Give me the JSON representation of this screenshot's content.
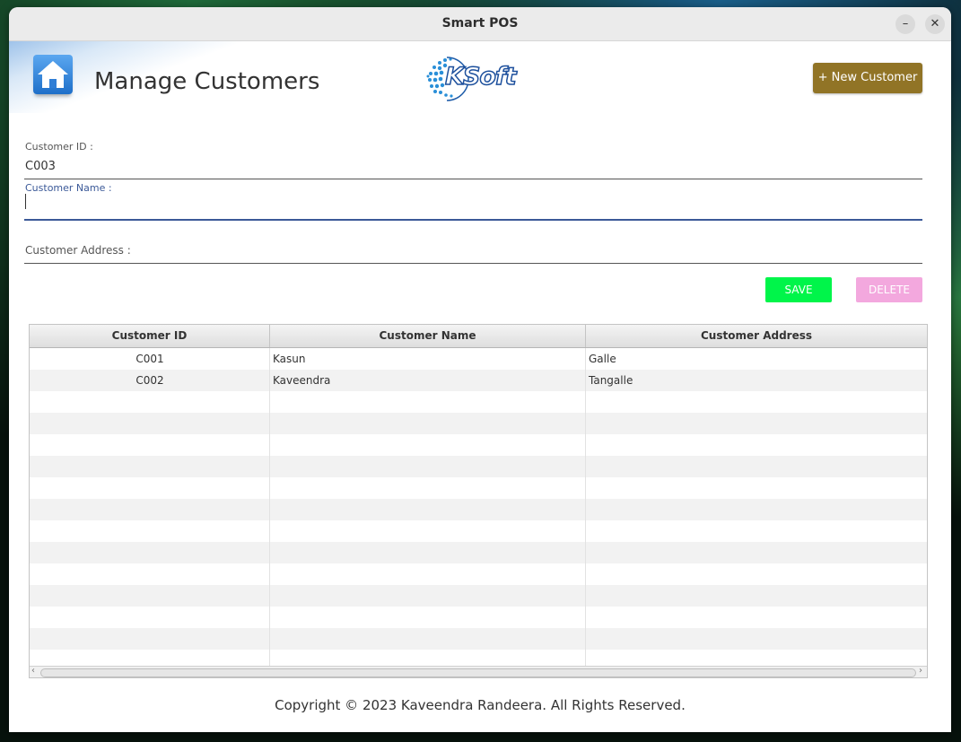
{
  "window": {
    "title": "Smart POS",
    "minimize_symbol": "–",
    "close_symbol": "✕"
  },
  "header": {
    "home_icon": "home-icon",
    "title": "Manage Customers",
    "logo_text": "KSoft",
    "new_customer_label": "+ New Customer",
    "new_customer_color": "#917426"
  },
  "form": {
    "customer_id": {
      "label": "Customer ID :",
      "value": "C003"
    },
    "customer_name": {
      "label": "Customer Name :",
      "value": ""
    },
    "customer_address": {
      "label": "Customer Address :",
      "value": ""
    }
  },
  "actions": {
    "save_label": "SAVE",
    "save_color": "#00f54a",
    "delete_label": "DELETE",
    "delete_color": "#f3a8de"
  },
  "table": {
    "columns": [
      "Customer ID",
      "Customer Name",
      "Customer Address"
    ],
    "rows": [
      {
        "id": "C001",
        "name": "Kasun",
        "address": "Galle"
      },
      {
        "id": "C002",
        "name": "Kaveendra",
        "address": "Tangalle"
      }
    ]
  },
  "footer": {
    "copyright": "Copyright © 2023 Kaveendra Randeera. All Rights Reserved."
  }
}
